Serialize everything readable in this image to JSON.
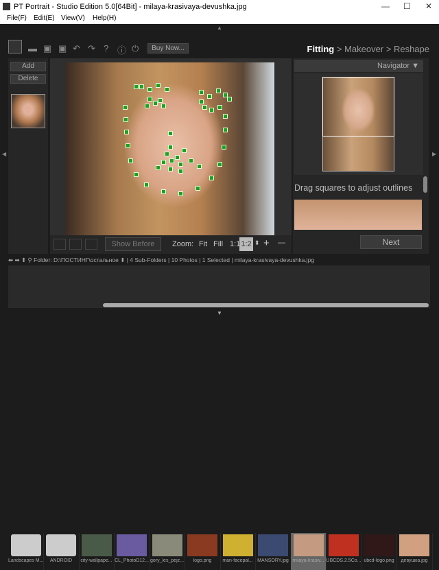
{
  "window": {
    "title": "PT Portrait - Studio Edition 5.0[64Bit] - milaya-krasivaya-devushka.jpg"
  },
  "menu": [
    "File(F)",
    "Edit(E)",
    "View(V)",
    "Help(H)"
  ],
  "toolbar": {
    "buy_label": "Buy Now...",
    "icons": [
      "logo-icon",
      "folder-open-icon",
      "save-icon",
      "save-as-icon",
      "undo-icon",
      "redo-icon",
      "help-icon",
      "info-icon",
      "plugin-icon"
    ]
  },
  "steps": {
    "fitting": "Fitting",
    "sep1": " > ",
    "makeover": "Makeover",
    "sep2": " > ",
    "reshape": "Reshape",
    "active_color": "#ffffff"
  },
  "left_panel": {
    "add_label": "Add",
    "delete_label": "Delete"
  },
  "canvas_controls": {
    "show_before": "Show Before",
    "zoom_label": "Zoom:",
    "fit": "Fit",
    "fill": "Fill",
    "one_one": "1:1",
    "one_two": "1:2",
    "plus": "+",
    "minus": "—"
  },
  "navigator": {
    "title": "Navigator ▼",
    "hint": "Drag squares to adjust outlines",
    "next_label": "Next"
  },
  "folder_bar": {
    "folder_label": "Folder:",
    "path": "D:\\ПОСТИНГ\\остальное ⬍",
    "info": "| 4 Sub-Folders | 10 Photos | 1 Selected | milaya-krasivaya-devushka.jpg"
  },
  "filmstrip": [
    {
      "name": "Landscapes M...",
      "type": "folder"
    },
    {
      "name": "ANDROID",
      "type": "folder"
    },
    {
      "name": "city-wallpape...",
      "type": "image"
    },
    {
      "name": "CL_PhotoD12...",
      "type": "image"
    },
    {
      "name": "gory_les_pejz...",
      "type": "image"
    },
    {
      "name": "logo.png",
      "type": "image"
    },
    {
      "name": "man-facepal...",
      "type": "image"
    },
    {
      "name": "MANSORY.jpg",
      "type": "image"
    },
    {
      "name": "milaya-krasiv...",
      "type": "image",
      "selected": true
    },
    {
      "name": "UBCDS.2.5Co...",
      "type": "image"
    },
    {
      "name": "ubcd-logo.png",
      "type": "image"
    },
    {
      "name": "девушка.jpg",
      "type": "image"
    }
  ],
  "colors": {
    "background": "#1c1c1c",
    "panel": "#2b2b2b",
    "landmark": "#1fa01f"
  }
}
